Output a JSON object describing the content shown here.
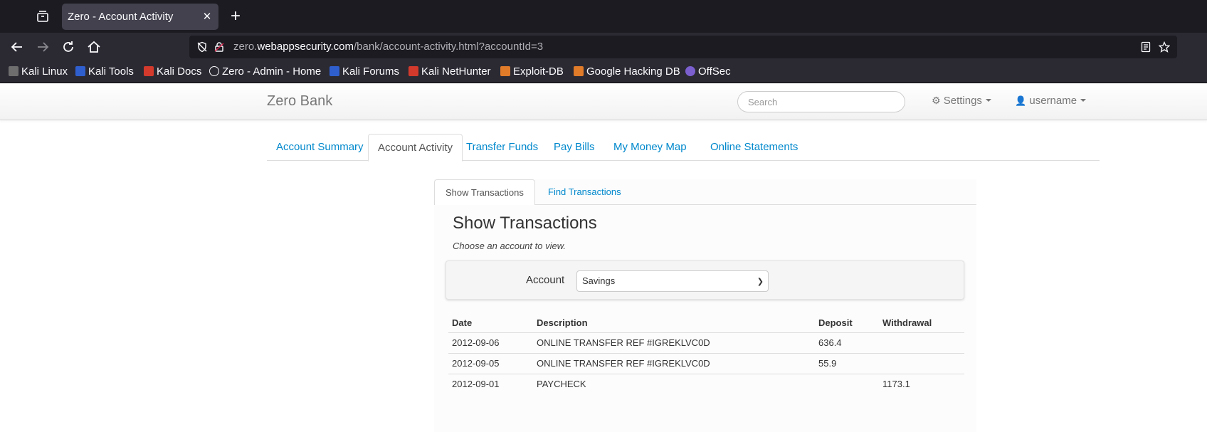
{
  "browser": {
    "tab_title": "Zero - Account Activity",
    "url_prefix": "zero.",
    "url_host": "webappsecurity.com",
    "url_path": "/bank/account-activity.html?accountId=3",
    "bookmarks": [
      {
        "label": "Kali Linux",
        "color": "#6e6e6e"
      },
      {
        "label": "Kali Tools",
        "color": "#2f5fcf"
      },
      {
        "label": "Kali Docs",
        "color": "#d33a2c"
      },
      {
        "label": "Zero - Admin - Home",
        "color": "#fbfbfe"
      },
      {
        "label": "Kali Forums",
        "color": "#2f5fcf"
      },
      {
        "label": "Kali NetHunter",
        "color": "#d33a2c"
      },
      {
        "label": "Exploit-DB",
        "color": "#e07b2a"
      },
      {
        "label": "Google Hacking DB",
        "color": "#e07b2a"
      },
      {
        "label": "OffSec",
        "color": "#7b5fcf"
      }
    ]
  },
  "site": {
    "brand": "Zero Bank",
    "search_placeholder": "Search",
    "settings_label": "Settings",
    "user_label": "username"
  },
  "main_tabs": [
    "Account Summary",
    "Account Activity",
    "Transfer Funds",
    "Pay Bills",
    "My Money Map",
    "Online Statements"
  ],
  "sub_tabs": [
    "Show Transactions",
    "Find Transactions"
  ],
  "panel": {
    "heading": "Show Transactions",
    "hint": "Choose an account to view.",
    "account_label": "Account",
    "account_selected": "Savings"
  },
  "table": {
    "headers": [
      "Date",
      "Description",
      "Deposit",
      "Withdrawal"
    ],
    "rows": [
      [
        "2012-09-06",
        "ONLINE TRANSFER REF #IGREKLVC0D",
        "636.4",
        ""
      ],
      [
        "2012-09-05",
        "ONLINE TRANSFER REF #IGREKLVC0D",
        "55.9",
        ""
      ],
      [
        "2012-09-01",
        "PAYCHECK",
        "",
        "1173.1"
      ]
    ]
  }
}
